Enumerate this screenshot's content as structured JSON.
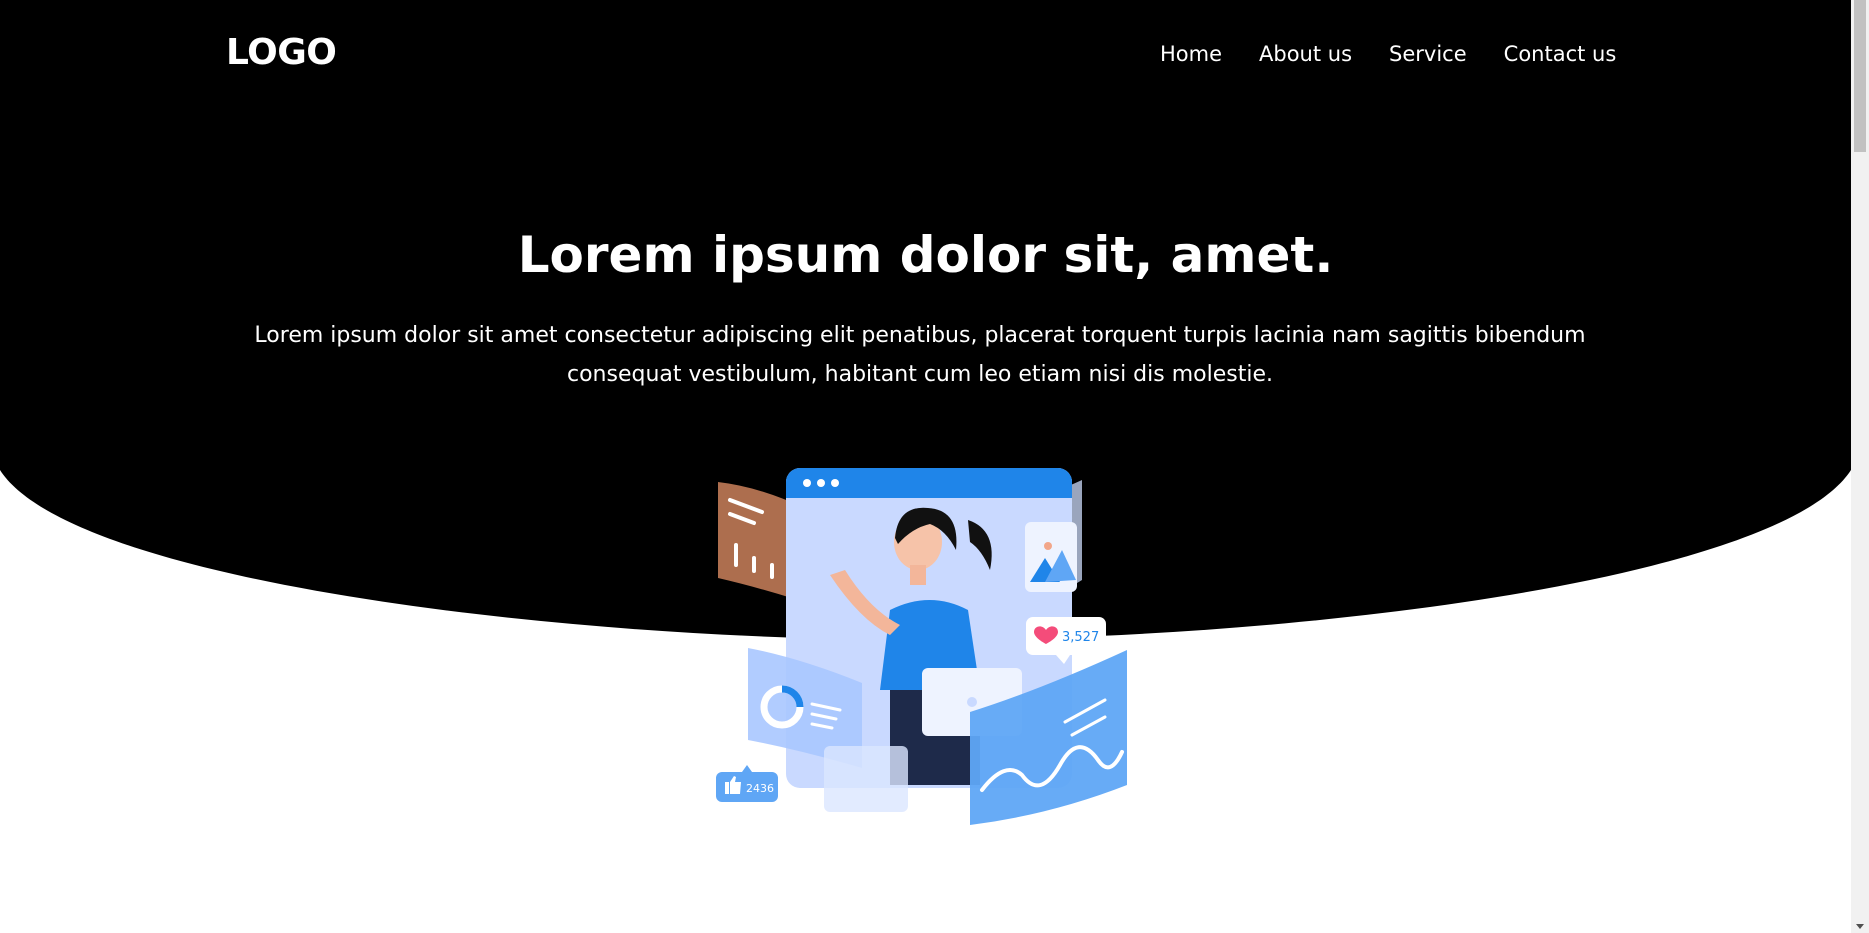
{
  "header": {
    "logo": "LOGO",
    "nav": [
      {
        "label": "Home"
      },
      {
        "label": "About us"
      },
      {
        "label": "Service"
      },
      {
        "label": "Contact us"
      }
    ]
  },
  "hero": {
    "title": "Lorem ipsum dolor sit, amet.",
    "text": "Lorem ipsum dolor sit amet consectetur adipiscing elit penatibus, placerat torquent turpis lacinia nam sagittis bibendum consequat vestibulum, habitant cum leo etiam nisi dis molestie."
  },
  "illustration": {
    "heart_count": "3,527",
    "like_count": "2436"
  },
  "colors": {
    "hero_bg": "#000000",
    "accent_blue": "#1f85e9",
    "text": "#ffffff"
  }
}
